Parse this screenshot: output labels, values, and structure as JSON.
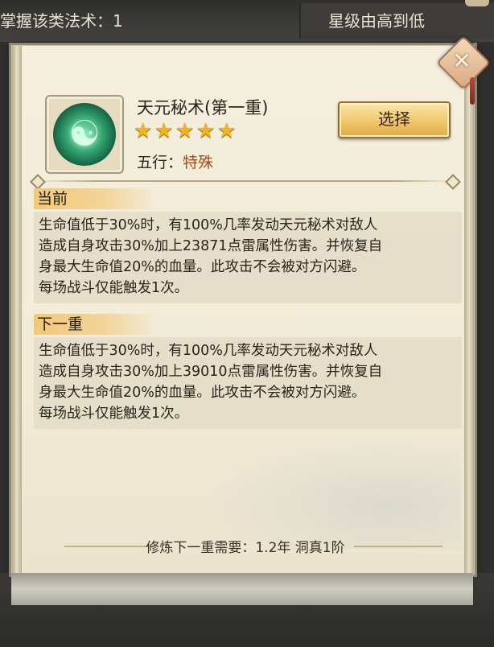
{
  "background": {
    "filter_left": "掌握该类法术：1",
    "filter_right": "星级由高到低"
  },
  "skill": {
    "name": "天元秘术(第一重)",
    "stars": [
      "★",
      "★",
      "★",
      "★",
      "★"
    ],
    "element_label": "五行：",
    "element_value": "特殊",
    "select_label": "选择"
  },
  "current": {
    "heading": "当前",
    "lines": [
      "生命值低于30%时，有100%几率发动天元秘术对敌人",
      "造成自身攻击30%加上23871点雷属性伤害。并恢复自",
      "身最大生命值20%的血量。此攻击不会被对方闪避。",
      "每场战斗仅能触发1次。"
    ]
  },
  "next": {
    "heading": "下一重",
    "lines": [
      "生命值低于30%时，有100%几率发动天元秘术对敌人",
      "造成自身攻击30%加上39010点雷属性伤害。并恢复自",
      "身最大生命值20%的血量。此攻击不会被对方闪避。",
      "每场战斗仅能触发1次。"
    ]
  },
  "footer": {
    "requirement": "修炼下一重需要：1.2年 洞真1阶"
  },
  "icons": {
    "close": "close-icon",
    "skill": "skill-emblem-icon",
    "star": "star-icon"
  },
  "colors": {
    "element_value": "#a54b16",
    "star": "#f3b21f",
    "button": "#f0c76a"
  }
}
